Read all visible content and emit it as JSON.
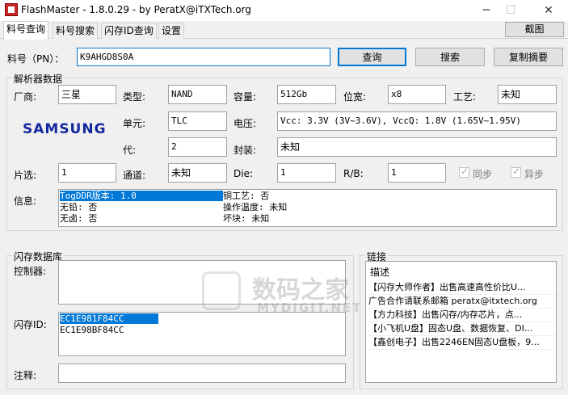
{
  "window": {
    "title": "FlashMaster - 1.8.0.29 - by PeratX@iTXTech.org",
    "minimize": "─",
    "maximize": "☐",
    "close": "✕"
  },
  "tabs": [
    {
      "label": "料号查询",
      "active": true
    },
    {
      "label": "料号搜索"
    },
    {
      "label": "闪存ID查询"
    },
    {
      "label": "设置"
    }
  ],
  "screenshot_button": "截图",
  "part_number": {
    "label": "料号（PN）：",
    "value": "K9AHGD8S0A"
  },
  "actions": {
    "query": "查询",
    "search": "搜索",
    "copy_summary": "复制摘要"
  },
  "parser": {
    "title": "解析器数据",
    "logo": "SAMSUNG",
    "vendor_label": "厂商:",
    "vendor": "三星",
    "type_label": "类型:",
    "type": "NAND",
    "capacity_label": "容量:",
    "capacity": "512Gb",
    "width_label": "位宽:",
    "width": "x8",
    "process_label": "工艺:",
    "process": "未知",
    "cell_label": "单元:",
    "cell": "TLC",
    "voltage_label": "电压:",
    "voltage": "Vcc: 3.3V (3V~3.6V), VccQ: 1.8V (1.65V~1.95V)",
    "gen_label": "代:",
    "gen": "2",
    "package_label": "封装:",
    "package": "未知",
    "ce_label": "片选:",
    "ce": "1",
    "channel_label": "通道:",
    "channel": "未知",
    "die_label": "Die:",
    "die": "1",
    "rb_label": "R/B:",
    "rb": "1",
    "sync_label": "同步",
    "async_label": "异步",
    "info_label": "信息:",
    "info": [
      [
        "TogDDR版本: 1.0",
        "铜工艺: 否"
      ],
      [
        "无铅: 否",
        "操作温度: 未知"
      ],
      [
        "无卤: 否",
        "坏块: 未知"
      ]
    ]
  },
  "flashdb": {
    "title": "闪存数据库",
    "controller_label": "控制器:",
    "controllers": [],
    "flash_id_label": "闪存ID:",
    "flash_ids": [
      "EC1E981F84CC",
      "EC1E98BF84CC"
    ],
    "comment_label": "注释:",
    "comment": ""
  },
  "links": {
    "title": "链接",
    "header": "描述",
    "rows": [
      "【闪存大师作者】出售高速高性价比U...",
      "广告合作请联系邮箱 peratx@itxtech.org",
      "【方力科技】出售闪存/内存芯片，点...",
      "【小飞机U盘】固态U盘、数据恢复、DI...",
      "【鑫创电子】出售2246EN固态U盘板，9..."
    ]
  },
  "watermark": {
    "main": "数码之家",
    "sub": "MYDIGIT.NET"
  }
}
